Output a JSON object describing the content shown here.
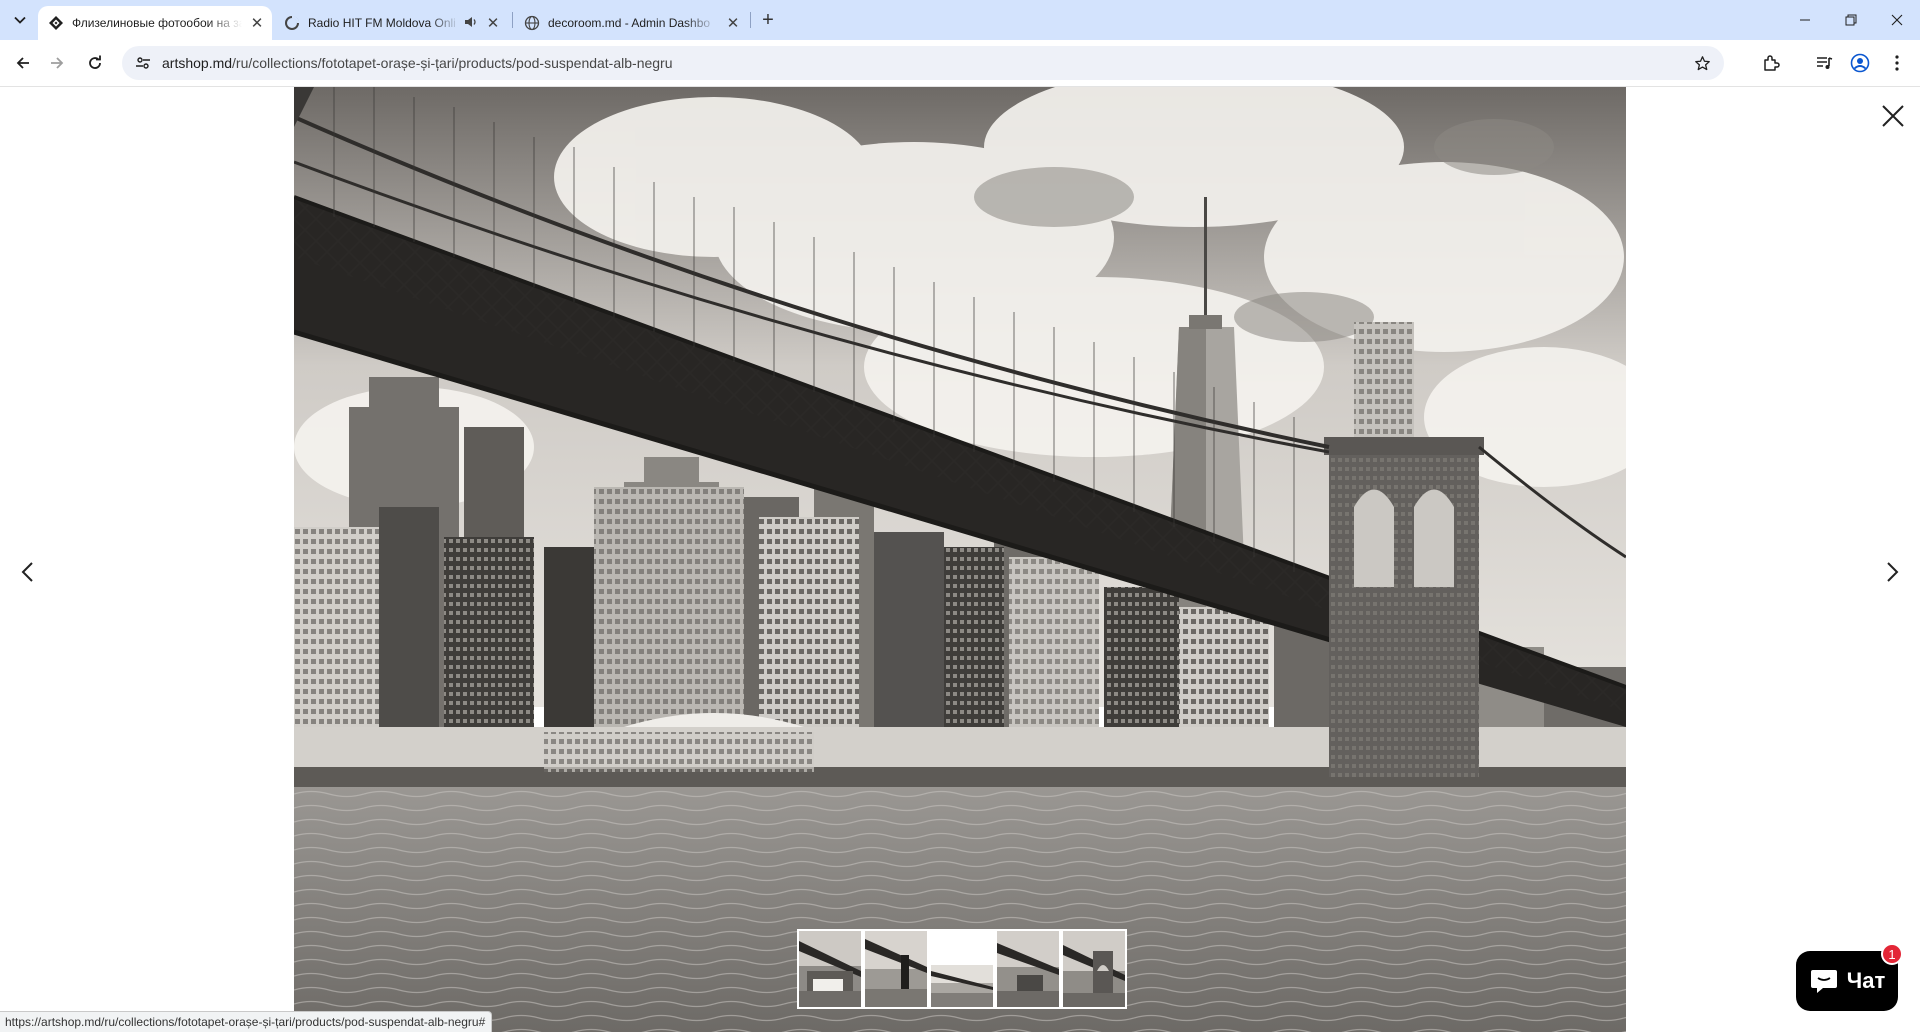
{
  "browser": {
    "tabs": [
      {
        "title": "Флизелиновые фотообои на за",
        "favicon": "diamond-logo-icon",
        "active": true
      },
      {
        "title": "Radio HIT FM Moldova Onli",
        "favicon": "loading-spinner-icon",
        "audio": "speaker-icon",
        "active": false
      },
      {
        "title": "decoroom.md - Admin Dashbo",
        "favicon": "globe-icon",
        "active": false
      }
    ],
    "url_host": "artshop.md",
    "url_path": "/ru/collections/fototapet-orașe-și-țari/products/pod-suspendat-alb-negru",
    "status_url": "https://artshop.md/ru/collections/fototapet-orașe-și-țari/products/pod-suspendat-alb-negru#"
  },
  "lightbox": {
    "image_subject": "bridge-city-skyline",
    "thumbnail_count": 5,
    "active_thumbnail": 3
  },
  "chat": {
    "label": "Чат",
    "badge_count": "1",
    "color": "#000000"
  },
  "colors": {
    "tabstrip": "#d3e3fd",
    "omnibox": "#eef1f8",
    "badge": "#e32636"
  }
}
